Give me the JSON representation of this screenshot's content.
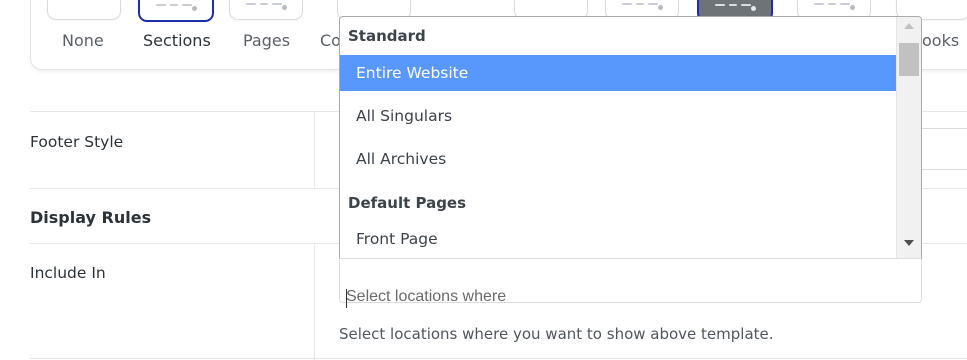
{
  "template_types": [
    {
      "label": "None",
      "selected": false
    },
    {
      "label": "Sections",
      "selected": true
    },
    {
      "label": "Pages",
      "selected": false
    },
    {
      "label": "Co",
      "selected": false
    },
    {
      "label": "ooks",
      "selected": false
    }
  ],
  "rows": {
    "footer_style": "Footer Style",
    "display_rules": "Display Rules",
    "include_in": "Include In"
  },
  "include_select": {
    "placeholder": "Select locations where",
    "help": "Select locations where you want to show above template."
  },
  "dropdown": {
    "groups": [
      {
        "label": "Standard",
        "items": [
          "Entire Website",
          "All Singulars",
          "All Archives"
        ]
      },
      {
        "label": "Default Pages",
        "items": [
          "Front Page"
        ]
      }
    ],
    "highlighted": "Entire Website"
  },
  "colors": {
    "highlight": "#5897fb",
    "selected_border": "#1d2ea8"
  },
  "icons": {
    "scroll_up": "triangle-up",
    "scroll_down": "triangle-down"
  }
}
